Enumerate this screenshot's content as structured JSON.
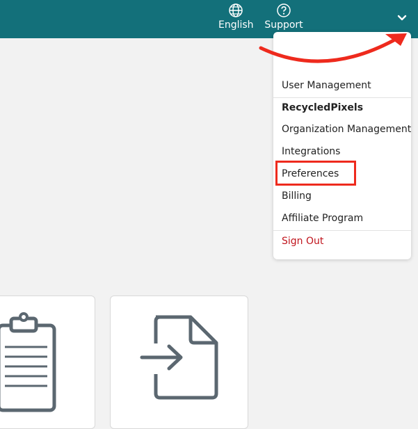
{
  "topbar": {
    "language": {
      "label": "English",
      "icon": "globe-icon"
    },
    "support": {
      "label": "Support",
      "icon": "help-circle-icon"
    },
    "account_menu": {
      "icon": "chevron-down-icon"
    },
    "bg_color": "#13707a"
  },
  "dropdown": {
    "items": [
      {
        "label": "User Management"
      },
      {
        "label": "RecycledPixels"
      },
      {
        "label": "Organization Management"
      },
      {
        "label": "Integrations"
      },
      {
        "label": "Preferences"
      },
      {
        "label": "Billing"
      },
      {
        "label": "Affiliate Program"
      },
      {
        "label": "Sign Out"
      }
    ],
    "highlight_color": "#ee2a1d",
    "signout_color": "#c0151d"
  },
  "cards": [
    {
      "icon": "clipboard-icon"
    },
    {
      "icon": "file-import-icon"
    }
  ]
}
